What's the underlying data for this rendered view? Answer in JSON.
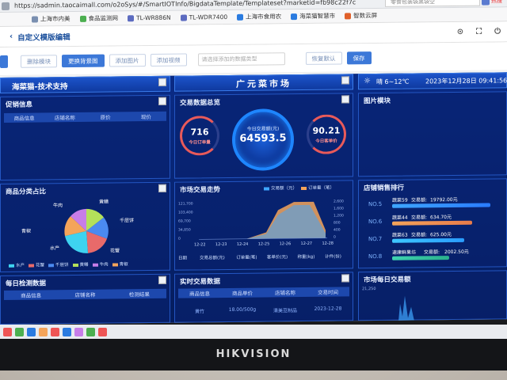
{
  "browser": {
    "url": "https://sadmin.taocaimall.com/o2oSys/#/SmartIOTInfo/BigdataTemplate/Templateset?marketid=fb98c22f7c",
    "search_placeholder": "零食包装袋黑袋空",
    "top_right_label": "热搜",
    "bookmarks": [
      "上海市内美",
      "食品监测网",
      "TL-WR886N",
      "TL-WDR7400",
      "上海市食用农",
      "海菜猫智慧市",
      "智数云屏"
    ]
  },
  "page": {
    "title": "自定义模版编辑",
    "back_icon": "chevron-left-icon"
  },
  "toolbar": {
    "buttons": [
      "删除模块",
      "更换背景图",
      "添加图片",
      "添加视频"
    ],
    "select_placeholder": "请选择添加的数据类型",
    "reset_label": "恢复默认",
    "save_label": "保存"
  },
  "dashboard": {
    "brand_title": "海菜猫-技术支持",
    "market_title": "广元菜市场",
    "weather": "晴 6~12℃",
    "datetime": "2023年12月28日 09:41:56",
    "promo": {
      "title": "促销信息",
      "cols": [
        "商品信息",
        "店铺名称",
        "原价",
        "现价"
      ]
    },
    "trade_summary": {
      "title": "交易数据总览",
      "orders_value": "716",
      "orders_label": "今日订单量",
      "amount_label": "今日交易额(元)",
      "amount_value": "64593.5",
      "avg_value": "90.21",
      "avg_label": "今日客单价"
    },
    "image_module": {
      "title": "图片模块"
    },
    "category": {
      "title": "商品分类占比",
      "labels": [
        "黄鳝",
        "千层饼",
        "花蟹",
        "牛肉",
        "青椒",
        "水产"
      ],
      "legend": [
        "水产",
        "花蟹",
        "千层饼",
        "黄鳝",
        "牛肉",
        "青椒"
      ],
      "colors": [
        "#3ed3f0",
        "#e86a6a",
        "#4b8af0",
        "#b3e05a",
        "#c77de8",
        "#f4a45a"
      ]
    },
    "trend": {
      "title": "市场交易走势",
      "legend": [
        "交易额（元）",
        "订单量（笔）"
      ],
      "y_left": [
        "121,700",
        "103,400",
        "69,700",
        "34,850",
        "0"
      ],
      "y_right": [
        "2,600",
        "1,600",
        "1,200",
        "800",
        "400",
        "0"
      ],
      "x": [
        "12-22",
        "12-23",
        "12-24",
        "12-25",
        "12-26",
        "12-27",
        "12-28"
      ],
      "table_cols": [
        "日期",
        "交易总额(元)",
        "订单量(笔)",
        "客单价(元)",
        "称重(kg)",
        "计件(份)"
      ]
    },
    "ranking": {
      "title": "店铺销售排行",
      "items": [
        {
          "no": "NO.5",
          "name": "蔬菜59",
          "label": "交易额:",
          "value": "19792.00元",
          "fill": 0.95
        },
        {
          "no": "NO.6",
          "name": "蔬菜44",
          "label": "交易额:",
          "value": "634.70元",
          "fill": 0.78
        },
        {
          "no": "NO.7",
          "name": "蔬菜63",
          "label": "交易额:",
          "value": "625.00元",
          "fill": 0.7
        },
        {
          "no": "NO.8",
          "name": "速康鲜果坊",
          "label": "交易额:",
          "value": "2002.50元",
          "fill": 0.55
        }
      ]
    },
    "daily_check": {
      "title": "每日检测数据",
      "cols": [
        "商品信息",
        "店铺名称",
        "检测结果"
      ]
    },
    "realtime": {
      "title": "实时交易数据",
      "cols": [
        "商品信息",
        "商品单价",
        "店铺名称",
        "交易时间"
      ],
      "row": [
        "黄竹",
        "18.00/500g",
        "清美豆制品",
        "2023-12-28"
      ]
    },
    "market_daily": {
      "title": "市场每日交易额",
      "y_top": "21,250"
    }
  },
  "monitor": {
    "brand": "HIKVISION"
  }
}
